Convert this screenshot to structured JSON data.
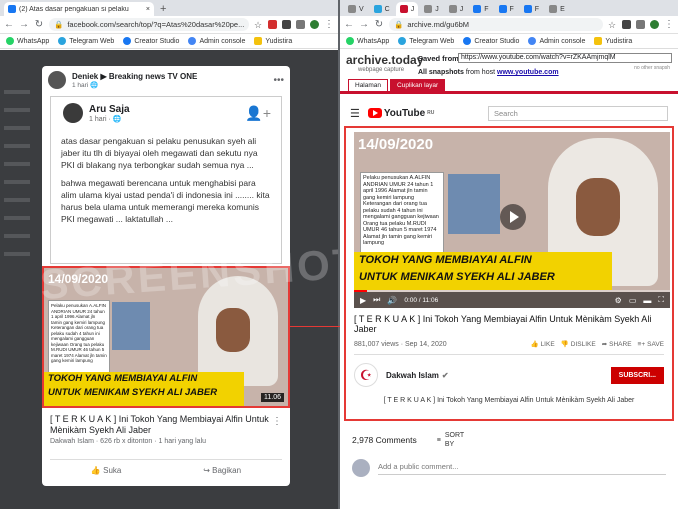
{
  "left": {
    "tabs": [
      {
        "title": "(2) Atas dasar pengakuan si pelaku",
        "close": "×",
        "active": true
      }
    ],
    "new_tab": "+",
    "url": "facebook.com/search/top/?q=Atas%20dasar%20pe...",
    "bookmarks": [
      "WhatsApp",
      "Telegram Web",
      "Creator Studio",
      "Admin console",
      "Yudistira"
    ],
    "post": {
      "author": "Deniek ▶ Breaking news TV ONE",
      "time": "1 hari",
      "inner_name": "Aru Saja",
      "inner_time": "1 hari · ",
      "paragraphs": [
        "atas dasar pengakuan si pelaku penusukan syeh ali jaber itu tlh di biyayai oleh megawati dan sekutu nya PKI di blakang nya terbongkar sudah semua nya ...",
        "bahwa megawati berencana untuk menghabisi para alim ulama kiyai ustad penda'i di indonesia ini ........ kita harus bela ulama untuk memerangi mereka komunis PKI megawati ... laktatullah ..."
      ],
      "video_date": "14/09/2020",
      "banner_line1": "TOKOH YANG MEMBIAYAI ALFIN",
      "banner_line2": "UNTUK MENIKAM SYEKH ALI JABER",
      "duration": "11.06",
      "title": "[ T E R K U A K ] Ini Tokoh Yang Membiayai Alfin Untuk Mènikàm Syekh Ali Jaber",
      "meta": "Dakwah Islam · 626 rb x ditonton · 1 hari yang lalu",
      "like": "Suka",
      "share": "Bagikan"
    },
    "watermark": "SCREENSHOT"
  },
  "poster_text": "Pelaku penusukan A.ALFIN ANDRIAN UMUR 24 tahun 1 april 1996 Alamat jln tamin gang kemiri lampung Keterangan dari orang tua pelaku sudah 4 tahun ini mengalami gangguan kejiwaan Orang tua pelaku M.RUDI UMUR 46 tahun 5 maret 1974 Alamat jln tamin gang kemiri lampung",
  "right": {
    "tabs": [
      "V",
      "C",
      "J",
      "J",
      "J",
      "F",
      "F",
      "F",
      "E"
    ],
    "url": "archive.md/gu6bM",
    "bookmarks": [
      "WhatsApp",
      "Telegram Web",
      "Creator Studio",
      "Admin console",
      "Yudistira"
    ],
    "archive": {
      "logo": "archive.today",
      "logo_sub": "webpage capture",
      "saved_from_label": "Saved from",
      "saved_from_url": "https://www.youtube.com/watch?v=rZKAAmjmqlM",
      "all_snapshots": "All snapshots",
      "from_host_label": "from host",
      "host": "www.youtube.com",
      "no_other": "no other snapsh",
      "tab_page": "Halaman",
      "tab_screenshot": "Cuplikan layar"
    },
    "youtube": {
      "search_placeholder": "Search",
      "logo": "YouTube",
      "logo_sup": "RU",
      "video_date": "14/09/2020",
      "banner_line1": "TOKOH YANG MEMBIAYAI ALFIN",
      "banner_line2": "UNTUK MENIKAM SYEKH ALI JABER",
      "time": "0:00 / 11:06",
      "title": "[ T E R K U A K ] Ini Tokoh Yang Membiayai Alfin Untuk Mènikàm Syekh Ali Jaber",
      "views": "881,007 views · Sep 14, 2020",
      "like": "LIKE",
      "dislike": "DISLIKE",
      "share": "SHARE",
      "save": "SAVE",
      "channel": "Dakwah Islam",
      "subscribe": "SUBSCRI...",
      "description": "[ T E R K U A K ] Ini Tokoh Yang Membiayai Alfin Untuk Mènikàm Syekh Ali Jaber",
      "comments": "2,978 Comments",
      "sort_by": "SORT BY",
      "add_comment": "Add a public comment..."
    }
  },
  "colors": {
    "accent_red": "#e53935",
    "archive_red": "#c8102e",
    "youtube_red": "#ff0000",
    "banner_yellow": "#f2d200"
  }
}
